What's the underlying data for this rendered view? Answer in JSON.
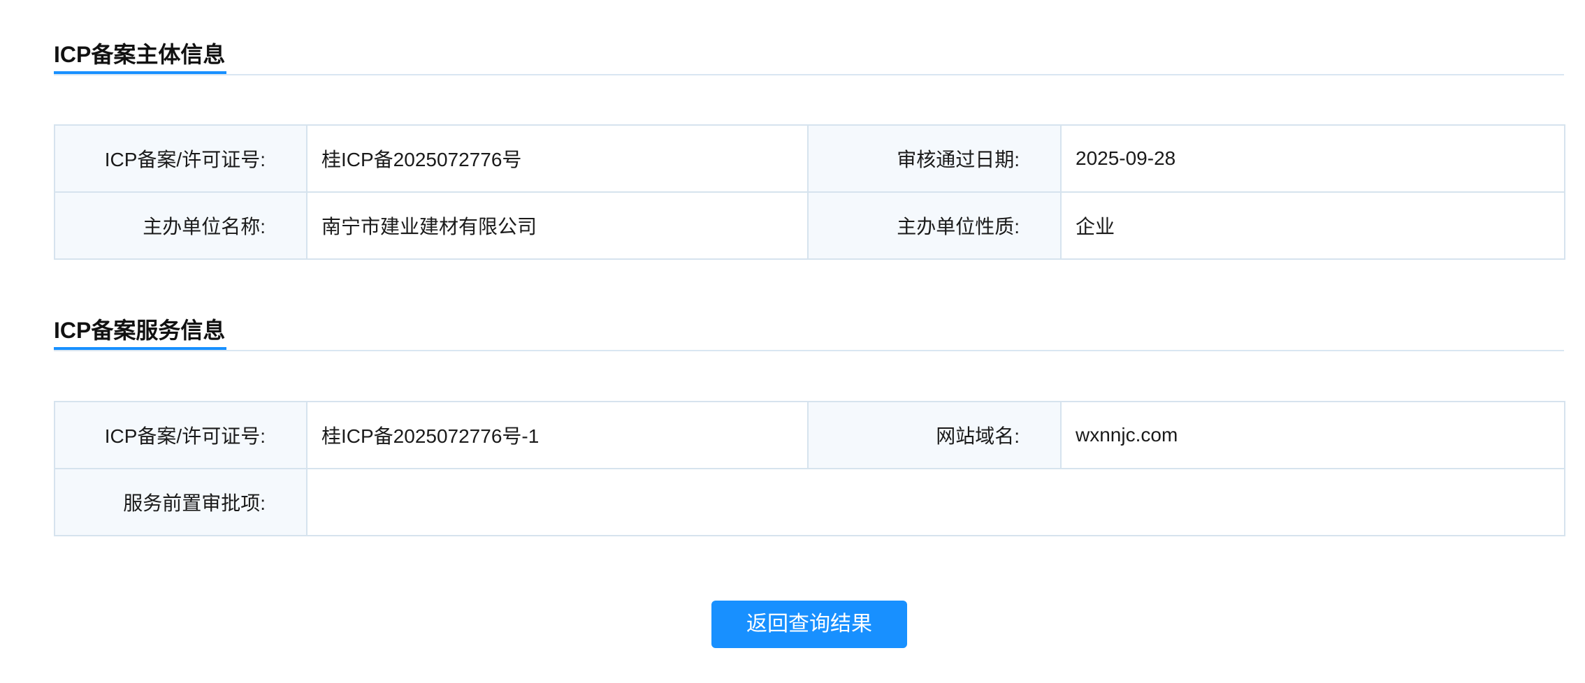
{
  "subject_section": {
    "title": "ICP备案主体信息",
    "rows": [
      {
        "label1": "ICP备案/许可证号:",
        "value1": "桂ICP备2025072776号",
        "label2": "审核通过日期:",
        "value2": "2025-09-28"
      },
      {
        "label1": "主办单位名称:",
        "value1": "南宁市建业建材有限公司",
        "label2": "主办单位性质:",
        "value2": "企业"
      }
    ]
  },
  "service_section": {
    "title": "ICP备案服务信息",
    "license_label": "ICP备案/许可证号:",
    "license_value": "桂ICP备2025072776号-1",
    "domain_label": "网站域名:",
    "domain_value": "wxnnjc.com",
    "approval_label": "服务前置审批项:",
    "approval_value": ""
  },
  "actions": {
    "back_label": "返回查询结果"
  },
  "colors": {
    "accent": "#1890ff",
    "label_bg": "#f5f9fd",
    "border": "#d6e3ee"
  }
}
